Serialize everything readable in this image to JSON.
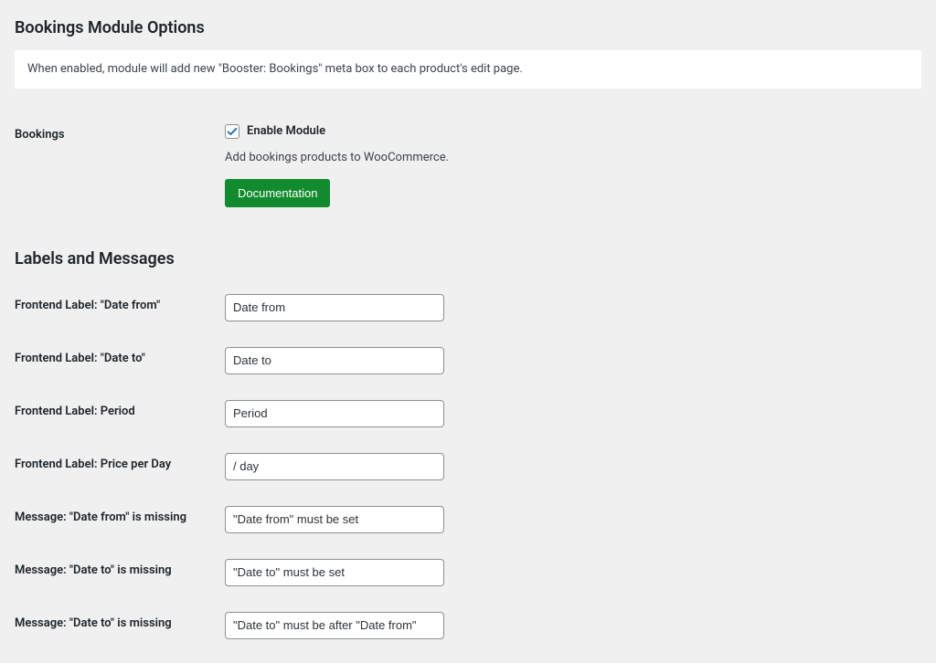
{
  "section1": {
    "title": "Bookings Module Options",
    "description": "When enabled, module will add new \"Booster: Bookings\" meta box to each product's edit page."
  },
  "bookings": {
    "label": "Bookings",
    "checkbox_label": "Enable Module",
    "checked": true,
    "help": "Add bookings products to WooCommerce.",
    "button": "Documentation"
  },
  "section2": {
    "title": "Labels and Messages"
  },
  "fields": {
    "date_from": {
      "label": "Frontend Label: \"Date from\"",
      "value": "Date from"
    },
    "date_to": {
      "label": "Frontend Label: \"Date to\"",
      "value": "Date to"
    },
    "period": {
      "label": "Frontend Label: Period",
      "value": "Period"
    },
    "price_per_day": {
      "label": "Frontend Label: Price per Day",
      "value": "/ day"
    },
    "msg_date_from_missing": {
      "label": "Message: \"Date from\" is missing",
      "value": "\"Date from\" must be set"
    },
    "msg_date_to_missing": {
      "label": "Message: \"Date to\" is missing",
      "value": "\"Date to\" must be set"
    },
    "msg_date_to_after": {
      "label": "Message: \"Date to\" is missing",
      "value": "\"Date to\" must be after \"Date from\""
    }
  }
}
